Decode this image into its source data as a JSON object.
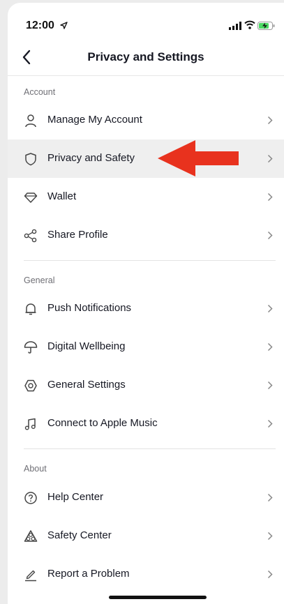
{
  "status": {
    "time": "12:00"
  },
  "header": {
    "title": "Privacy and Settings"
  },
  "sections": [
    {
      "label": "Account",
      "items": [
        {
          "label": "Manage My Account",
          "icon": "person-icon"
        },
        {
          "label": "Privacy and Safety",
          "icon": "shield-icon",
          "highlighted": true
        },
        {
          "label": "Wallet",
          "icon": "diamond-icon"
        },
        {
          "label": "Share Profile",
          "icon": "share-icon"
        }
      ]
    },
    {
      "label": "General",
      "items": [
        {
          "label": "Push Notifications",
          "icon": "bell-icon"
        },
        {
          "label": "Digital Wellbeing",
          "icon": "umbrella-icon"
        },
        {
          "label": "General Settings",
          "icon": "gear-icon"
        },
        {
          "label": "Connect to Apple Music",
          "icon": "music-note-icon"
        }
      ]
    },
    {
      "label": "About",
      "items": [
        {
          "label": "Help Center",
          "icon": "question-circle-icon"
        },
        {
          "label": "Safety Center",
          "icon": "safety-icon"
        },
        {
          "label": "Report a Problem",
          "icon": "pencil-icon"
        }
      ]
    }
  ],
  "colors": {
    "annotation_arrow": "#e8321e",
    "highlight_row": "#efefef"
  }
}
